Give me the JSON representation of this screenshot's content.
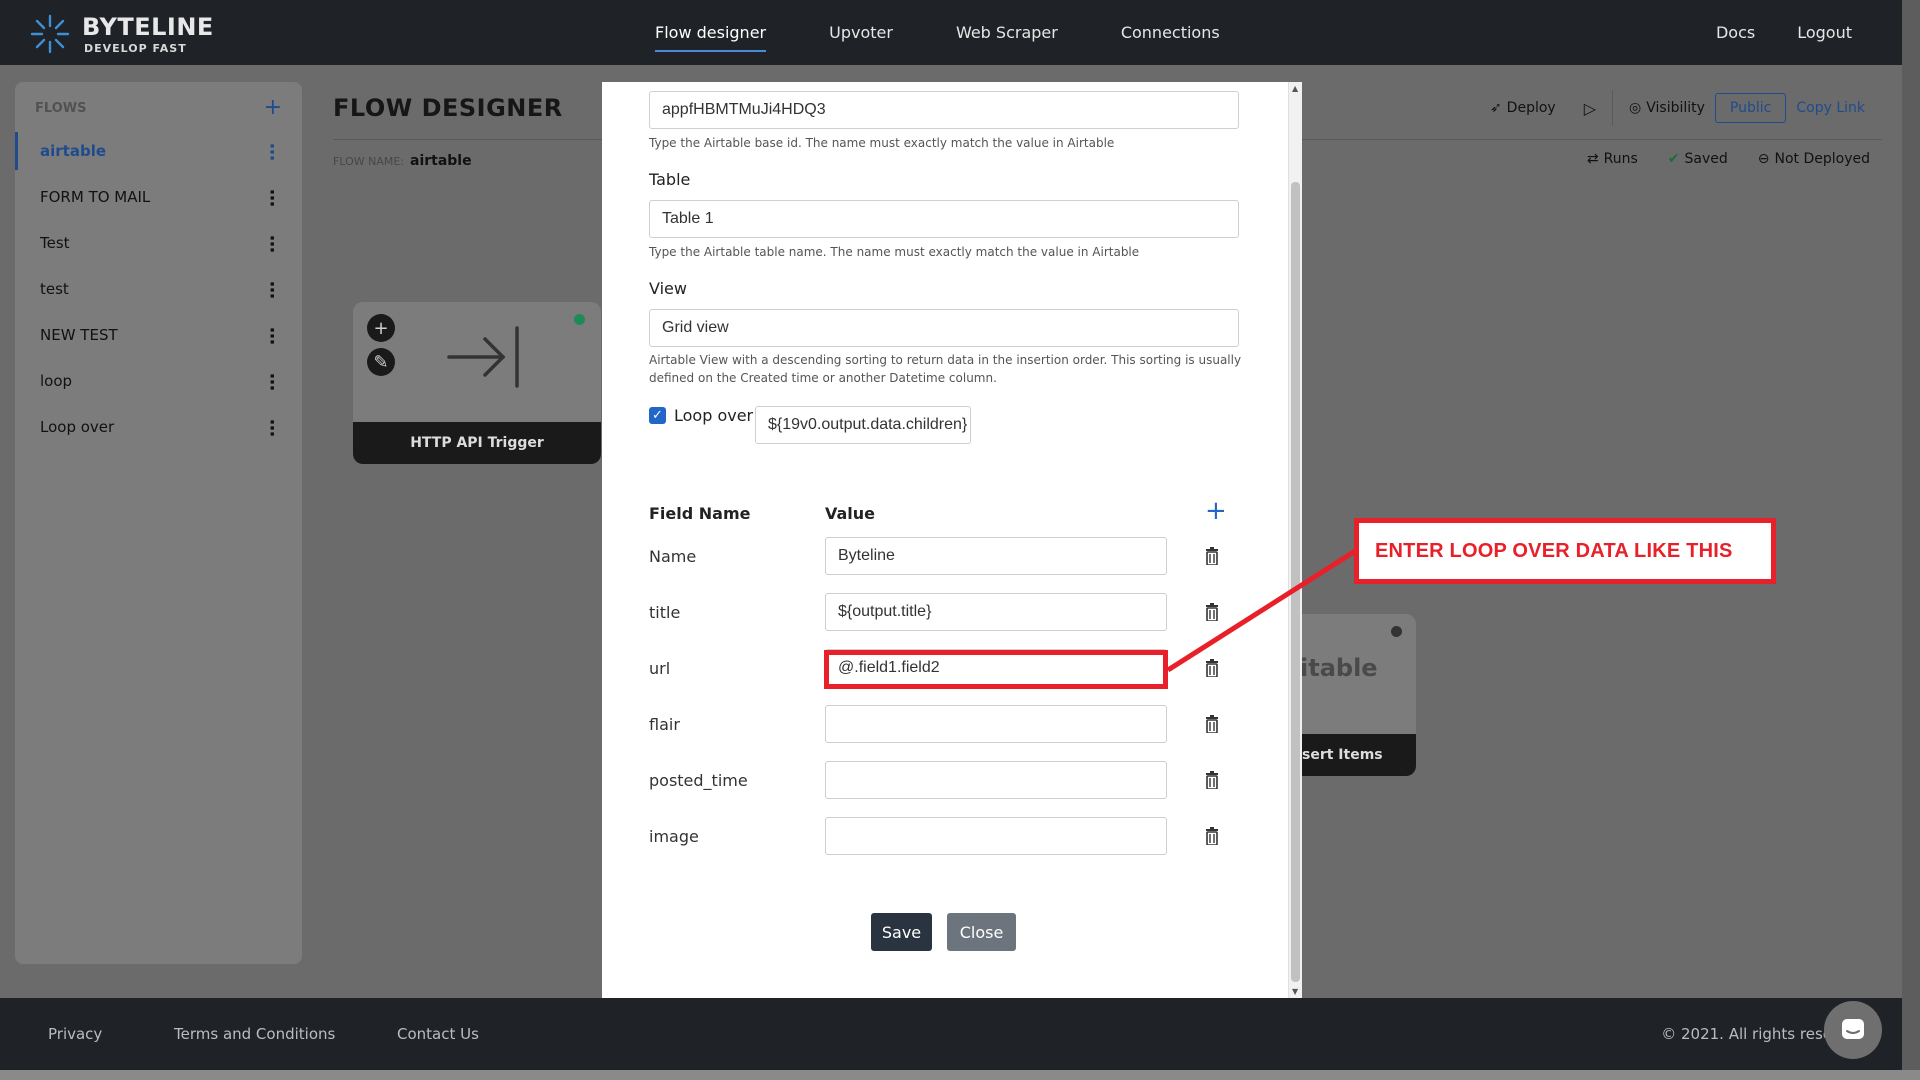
{
  "nav": {
    "brand": "BYTELINE",
    "tagline": "DEVELOP FAST",
    "links": [
      "Flow designer",
      "Upvoter",
      "Web Scraper",
      "Connections"
    ],
    "docs": "Docs",
    "logout": "Logout"
  },
  "sidebar": {
    "title": "FLOWS",
    "add": "+",
    "items": [
      {
        "label": "airtable"
      },
      {
        "label": "FORM TO MAIL"
      },
      {
        "label": "Test"
      },
      {
        "label": "test"
      },
      {
        "label": "NEW TEST"
      },
      {
        "label": "loop"
      },
      {
        "label": "Loop over"
      }
    ]
  },
  "main": {
    "title": "FLOW DESIGNER",
    "flow_name_label": "FLOW NAME:",
    "flow_name": "airtable",
    "deploy": "Deploy",
    "visibility": "Visibility",
    "public": "Public",
    "copy_link": "Copy Link",
    "runs": "Runs",
    "saved": "Saved",
    "not_deployed": "Not Deployed",
    "trigger_node_label": "HTTP API Trigger",
    "airtable_node_logo_text": "itable",
    "airtable_node_label": "sert Items"
  },
  "modal": {
    "base_id_value": "appfHBMTMuJi4HDQ3",
    "base_id_help": "Type the Airtable base id. The name must exactly match the value in Airtable",
    "table_label": "Table",
    "table_value": "Table 1",
    "table_help": "Type the Airtable table name. The name must exactly match the value in Airtable",
    "view_label": "View",
    "view_value": "Grid view",
    "view_help": "Airtable View with a descending sorting to return data in the insertion order. This sorting is usually defined on the Created time or another Datetime column.",
    "loop_over_label": "Loop over",
    "loop_over_checked": true,
    "loop_over_value": "${19v0.output.data.children}",
    "field_name_header": "Field Name",
    "value_header": "Value",
    "fields": [
      {
        "name": "Name",
        "value": "Byteline"
      },
      {
        "name": "title",
        "value": "${output.title}"
      },
      {
        "name": "url",
        "value": "@.field1.field2"
      },
      {
        "name": "flair",
        "value": ""
      },
      {
        "name": "posted_time",
        "value": ""
      },
      {
        "name": "image",
        "value": ""
      }
    ],
    "save": "Save",
    "close": "Close"
  },
  "annotation": {
    "callout_text": "ENTER LOOP OVER DATA LIKE THIS",
    "color": "#e8202a"
  },
  "footer": {
    "privacy": "Privacy",
    "terms": "Terms and Conditions",
    "contact": "Contact Us",
    "copyright": "© 2021. All rights rese"
  },
  "colors": {
    "nav_bg": "#1f2327",
    "accent": "#2266c8",
    "save_btn": "#2a3440",
    "close_btn": "#6c757d"
  }
}
